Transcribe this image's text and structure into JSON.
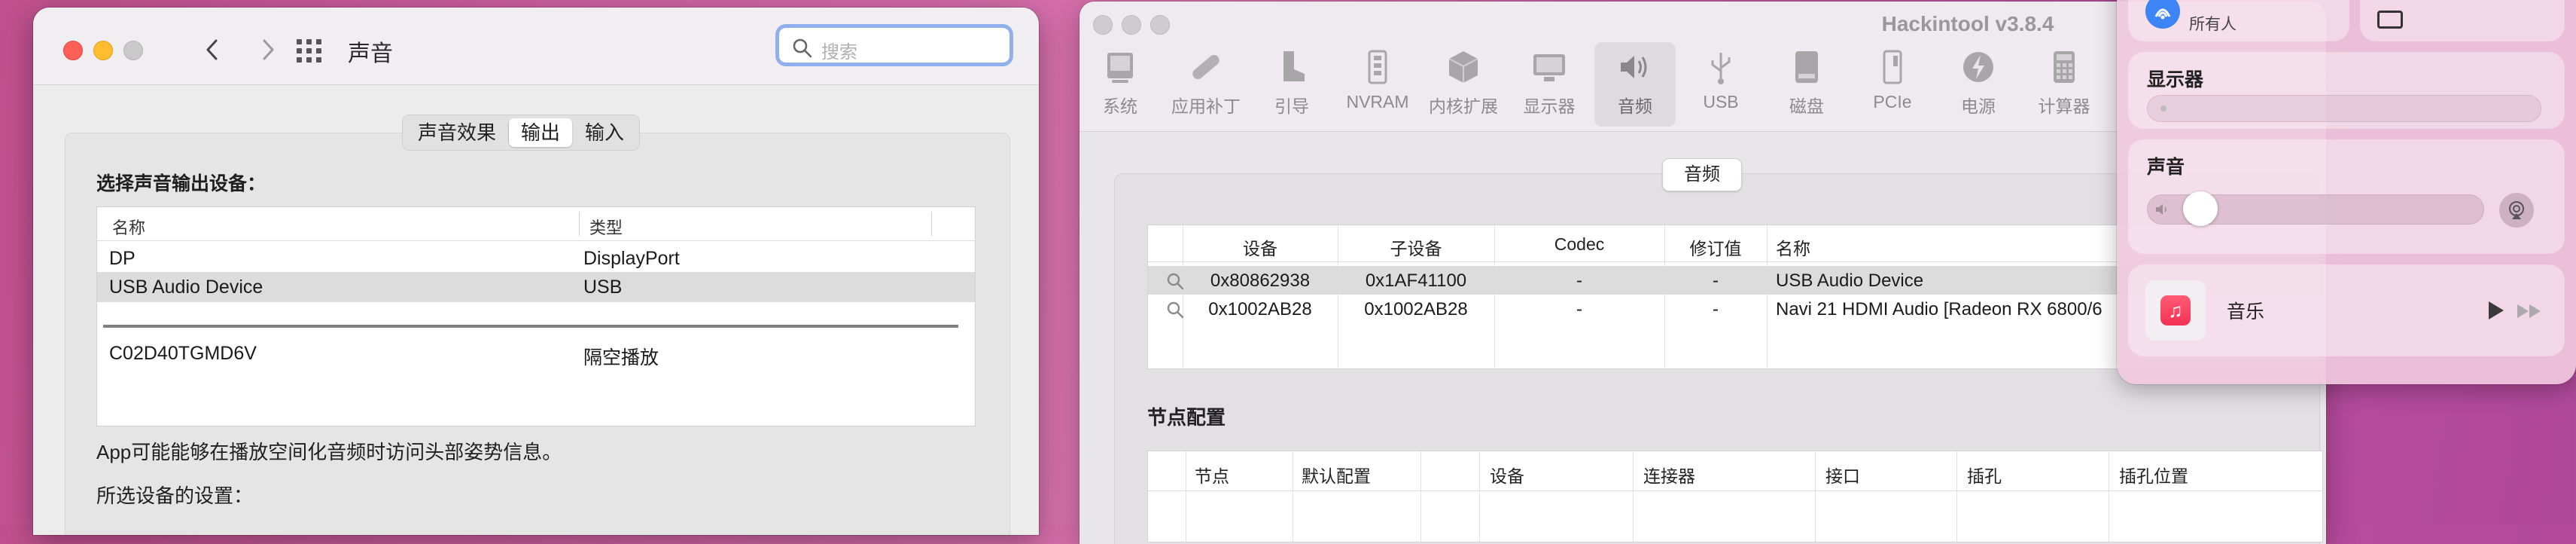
{
  "sound_window": {
    "title": "声音",
    "search_placeholder": "搜索",
    "tabs": [
      {
        "label": "声音效果",
        "active": false
      },
      {
        "label": "输出",
        "active": true
      },
      {
        "label": "输入",
        "active": false
      }
    ],
    "section_label": "选择声音输出设备：",
    "table": {
      "columns": [
        "名称",
        "类型"
      ],
      "rows": [
        {
          "name": "DP",
          "type": "DisplayPort",
          "selected": false
        },
        {
          "name": "USB Audio Device",
          "type": "USB",
          "selected": true
        },
        {
          "name": "C02D40TGMD6V",
          "type": "隔空播放",
          "selected": false
        }
      ]
    },
    "note": "App可能能够在播放空间化音频时访问头部姿势信息。",
    "settings_label": "所选设备的设置："
  },
  "hackintool": {
    "title": "Hackintool v3.8.4",
    "toolbar": [
      {
        "label": "系统",
        "icon": "computer-icon"
      },
      {
        "label": "应用补丁",
        "icon": "bandage-icon"
      },
      {
        "label": "引导",
        "icon": "boot-icon"
      },
      {
        "label": "NVRAM",
        "icon": "nvram-icon"
      },
      {
        "label": "内核扩展",
        "icon": "kext-box-icon"
      },
      {
        "label": "显示器",
        "icon": "display-icon"
      },
      {
        "label": "音频",
        "icon": "speaker-icon",
        "active": true
      },
      {
        "label": "USB",
        "icon": "usb-icon"
      },
      {
        "label": "磁盘",
        "icon": "disk-icon"
      },
      {
        "label": "PCIe",
        "icon": "pcie-icon"
      },
      {
        "label": "电源",
        "icon": "power-icon"
      },
      {
        "label": "计算器",
        "icon": "calculator-icon"
      }
    ],
    "audio_tab": "音频",
    "audio_table": {
      "columns": [
        "设备",
        "子设备",
        "Codec",
        "修订值",
        "名称"
      ],
      "rows": [
        {
          "device": "0x80862938",
          "subdevice": "0x1AF41100",
          "codec": "-",
          "revision": "-",
          "name": "USB Audio Device",
          "selected": true
        },
        {
          "device": "0x1002AB28",
          "subdevice": "0x1002AB28",
          "codec": "-",
          "revision": "-",
          "name": "Navi 21 HDMI Audio [Radeon RX 6800/6",
          "selected": false
        }
      ]
    },
    "node_section_title": "节点配置",
    "node_table_columns": [
      "节点",
      "默认配置",
      "设备",
      "连接器",
      "接口",
      "插孔",
      "插孔位置"
    ]
  },
  "control_center": {
    "airdrop_label": "所有人",
    "display_label": "显示器",
    "sound_label": "声音",
    "sound_volume_fraction": 0.12,
    "music_label": "音乐"
  }
}
